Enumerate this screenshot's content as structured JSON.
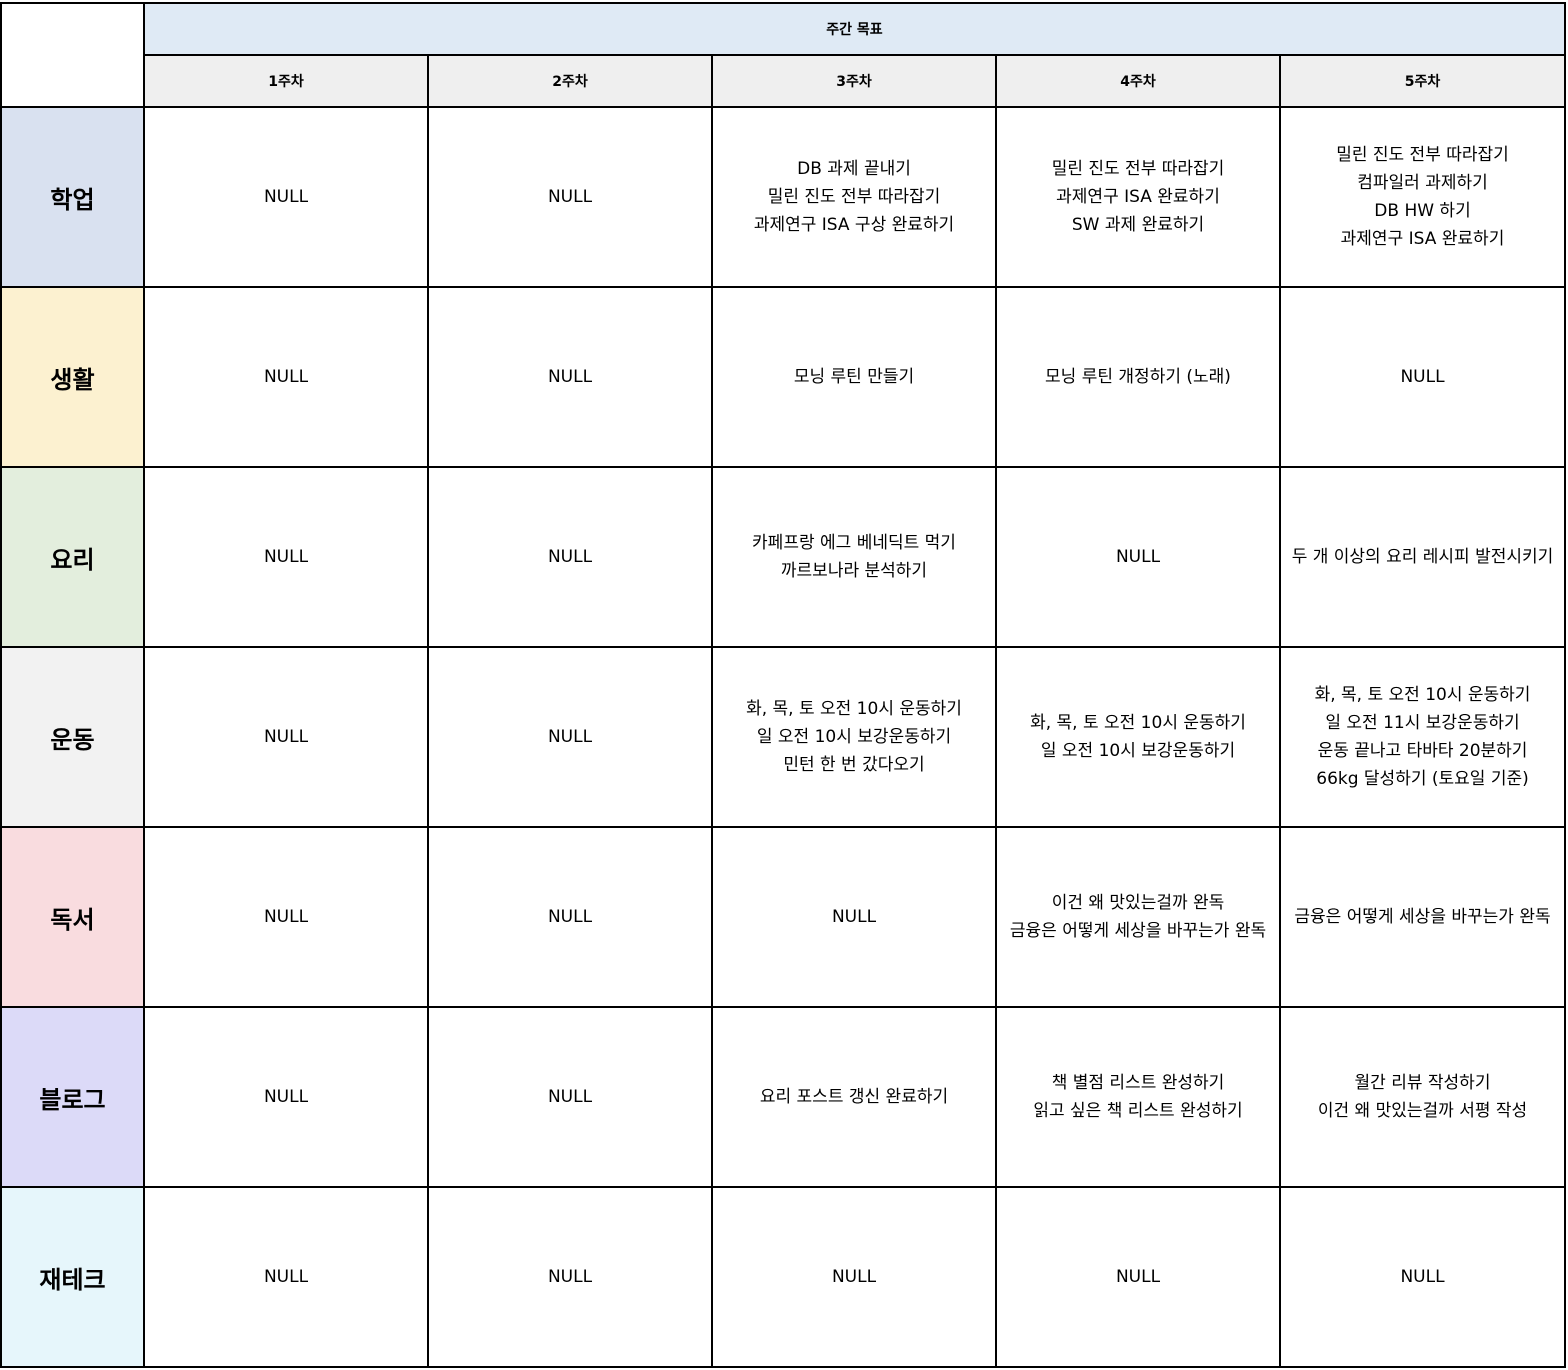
{
  "header": {
    "title": "주간 목표",
    "title_bg": "#dfeaf5",
    "weeks": [
      "1주차",
      "2주차",
      "3주차",
      "4주차",
      "5주차"
    ]
  },
  "rows": [
    {
      "category": "학업",
      "color": "#d9e1f0",
      "cells": [
        [
          "NULL"
        ],
        [
          "NULL"
        ],
        [
          "DB 과제 끝내기",
          "밀린 진도 전부 따라잡기",
          "과제연구 ISA 구상 완료하기"
        ],
        [
          "밀린 진도 전부 따라잡기",
          "과제연구 ISA 완료하기",
          "SW 과제 완료하기"
        ],
        [
          "밀린 진도 전부 따라잡기",
          "컴파일러 과제하기",
          "DB HW 하기",
          "과제연구 ISA 완료하기"
        ]
      ]
    },
    {
      "category": "생활",
      "color": "#fcf1d0",
      "cells": [
        [
          "NULL"
        ],
        [
          "NULL"
        ],
        [
          "모닝 루틴 만들기"
        ],
        [
          "모닝 루틴 개정하기 (노래)"
        ],
        [
          "NULL"
        ]
      ]
    },
    {
      "category": "요리",
      "color": "#e3eedd",
      "cells": [
        [
          "NULL"
        ],
        [
          "NULL"
        ],
        [
          "카페프랑 에그 베네딕트 먹기",
          "까르보나라 분석하기"
        ],
        [
          "NULL"
        ],
        [
          "두 개 이상의 요리 레시피 발전시키기"
        ]
      ]
    },
    {
      "category": "운동",
      "color": "#f2f2f2",
      "cells": [
        [
          "NULL"
        ],
        [
          "NULL"
        ],
        [
          "화, 목, 토 오전 10시 운동하기",
          "일 오전 10시 보강운동하기",
          "민턴 한 번 갔다오기"
        ],
        [
          "화, 목, 토 오전 10시 운동하기",
          "일 오전 10시 보강운동하기"
        ],
        [
          "화, 목, 토 오전 10시 운동하기",
          "일 오전 11시 보강운동하기",
          "운동 끝나고 타바타 20분하기",
          "66kg 달성하기 (토요일 기준)"
        ]
      ]
    },
    {
      "category": "독서",
      "color": "#f9dcdf",
      "cells": [
        [
          "NULL"
        ],
        [
          "NULL"
        ],
        [
          "NULL"
        ],
        [
          "이건 왜 맛있는걸까 완독",
          "금융은 어떻게 세상을 바꾸는가 완독"
        ],
        [
          "금융은 어떻게 세상을 바꾸는가 완독"
        ]
      ]
    },
    {
      "category": "블로그",
      "color": "#dcdaf8",
      "cells": [
        [
          "NULL"
        ],
        [
          "NULL"
        ],
        [
          "요리 포스트 갱신 완료하기"
        ],
        [
          "책 별점 리스트 완성하기",
          "읽고 싶은 책 리스트 완성하기"
        ],
        [
          "월간 리뷰 작성하기",
          "이건 왜 맛있는걸까 서평 작성"
        ]
      ]
    },
    {
      "category": "재테크",
      "color": "#e6f6fb",
      "cells": [
        [
          "NULL"
        ],
        [
          "NULL"
        ],
        [
          "NULL"
        ],
        [
          "NULL"
        ],
        [
          "NULL"
        ]
      ]
    }
  ]
}
